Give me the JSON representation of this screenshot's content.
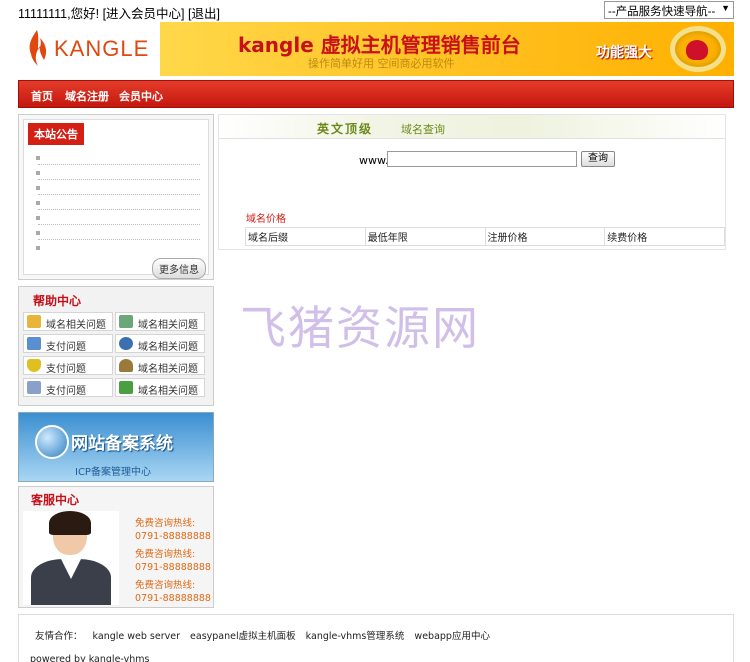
{
  "topbar": {
    "greeting": "11111111,您好!",
    "member_center": "[进入会员中心]",
    "logout": "[退出]",
    "quicknav": "--产品服务快速导航--"
  },
  "banner": {
    "brand": "KANGLE",
    "title": "kangle 虚拟主机管理销售前台",
    "subtitle": "操作简单好用 空间商必用软件",
    "slogan": "功能强大"
  },
  "nav": [
    "首页",
    "域名注册",
    "会员中心"
  ],
  "notice": {
    "title": "本站公告",
    "more": "更多信息"
  },
  "help": {
    "title": "帮助中心",
    "items": [
      {
        "label": "域名相关问题",
        "icon": "folder-icon"
      },
      {
        "label": "域名相关问题",
        "icon": "monitor-icon"
      },
      {
        "label": "支付问题",
        "icon": "computer-icon"
      },
      {
        "label": "域名相关问题",
        "icon": "eye-icon"
      },
      {
        "label": "支付问题",
        "icon": "shield-icon"
      },
      {
        "label": "域名相关问题",
        "icon": "user-icon"
      },
      {
        "label": "支付问题",
        "icon": "card-icon"
      },
      {
        "label": "域名相关问题",
        "icon": "download-icon"
      }
    ]
  },
  "beian": {
    "title": "网站备案系统",
    "subtitle": "ICP备案管理中心"
  },
  "service": {
    "title": "客服中心",
    "hotlines": [
      {
        "label": "免费咨询热线:",
        "number": "0791-88888888"
      },
      {
        "label": "免费咨询热线:",
        "number": "0791-88888888"
      },
      {
        "label": "免费咨询热线:",
        "number": "0791-88888888"
      }
    ]
  },
  "domain": {
    "tab_main": "英文顶级",
    "tab_sub": "域名查询",
    "prefix": "www.",
    "query_button": "查询",
    "price_title": "域名价格",
    "columns": [
      "域名后缀",
      "最低年限",
      "注册价格",
      "续费价格"
    ]
  },
  "watermark": "飞猪资源网",
  "footer": {
    "links_label": "友情合作：",
    "links": [
      "kangle web server",
      "easypanel虚拟主机面板",
      "kangle-vhms管理系统",
      "webapp应用中心"
    ],
    "powered": "powered by kangle-vhms"
  },
  "colors": {
    "nav_red": "#d41f14",
    "accent_orange": "#e06a17",
    "banner_yellow": "#ffc01f"
  }
}
